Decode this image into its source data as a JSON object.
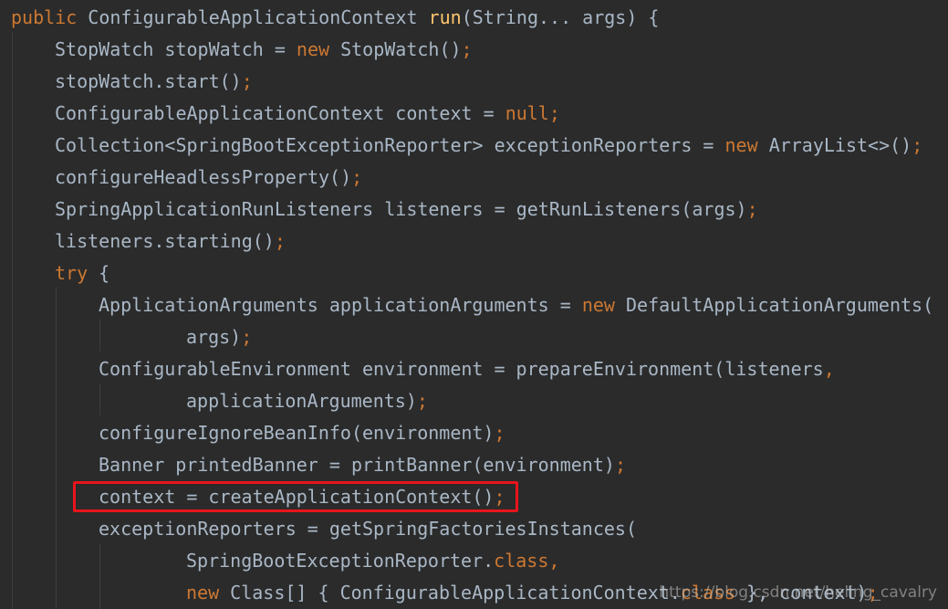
{
  "editor": {
    "lines": [
      {
        "indent": 0,
        "tokens": [
          {
            "t": "kw",
            "v": "public "
          },
          {
            "t": "plain",
            "v": "ConfigurableApplicationContext "
          },
          {
            "t": "fn",
            "v": "run"
          },
          {
            "t": "plain",
            "v": "(String... args) {"
          }
        ]
      },
      {
        "indent": 1,
        "tokens": [
          {
            "t": "plain",
            "v": "StopWatch stopWatch = "
          },
          {
            "t": "kw",
            "v": "new "
          },
          {
            "t": "plain",
            "v": "StopWatch()"
          },
          {
            "t": "punct",
            "v": ";"
          }
        ]
      },
      {
        "indent": 1,
        "tokens": [
          {
            "t": "plain",
            "v": "stopWatch.start()"
          },
          {
            "t": "punct",
            "v": ";"
          }
        ]
      },
      {
        "indent": 1,
        "tokens": [
          {
            "t": "plain",
            "v": "ConfigurableApplicationContext context = "
          },
          {
            "t": "kw",
            "v": "null"
          },
          {
            "t": "punct",
            "v": ";"
          }
        ]
      },
      {
        "indent": 1,
        "tokens": [
          {
            "t": "plain",
            "v": "Collection<SpringBootExceptionReporter> exceptionReporters = "
          },
          {
            "t": "kw",
            "v": "new "
          },
          {
            "t": "plain",
            "v": "ArrayList<>()"
          },
          {
            "t": "punct",
            "v": ";"
          }
        ]
      },
      {
        "indent": 1,
        "tokens": [
          {
            "t": "plain",
            "v": "configureHeadlessProperty()"
          },
          {
            "t": "punct",
            "v": ";"
          }
        ]
      },
      {
        "indent": 1,
        "tokens": [
          {
            "t": "plain",
            "v": "SpringApplicationRunListeners listeners = getRunListeners(args)"
          },
          {
            "t": "punct",
            "v": ";"
          }
        ]
      },
      {
        "indent": 1,
        "tokens": [
          {
            "t": "plain",
            "v": "listeners.starting()"
          },
          {
            "t": "punct",
            "v": ";"
          }
        ]
      },
      {
        "indent": 1,
        "tokens": [
          {
            "t": "kw",
            "v": "try "
          },
          {
            "t": "plain",
            "v": "{"
          }
        ]
      },
      {
        "indent": 2,
        "tokens": [
          {
            "t": "plain",
            "v": "ApplicationArguments applicationArguments = "
          },
          {
            "t": "kw",
            "v": "new "
          },
          {
            "t": "plain",
            "v": "DefaultApplicationArguments("
          }
        ]
      },
      {
        "indent": 4,
        "tokens": [
          {
            "t": "plain",
            "v": "args)"
          },
          {
            "t": "punct",
            "v": ";"
          }
        ]
      },
      {
        "indent": 2,
        "tokens": [
          {
            "t": "plain",
            "v": "ConfigurableEnvironment environment = prepareEnvironment(listeners"
          },
          {
            "t": "punct",
            "v": ","
          }
        ]
      },
      {
        "indent": 4,
        "tokens": [
          {
            "t": "plain",
            "v": "applicationArguments)"
          },
          {
            "t": "punct",
            "v": ";"
          }
        ]
      },
      {
        "indent": 2,
        "tokens": [
          {
            "t": "plain",
            "v": "configureIgnoreBeanInfo(environment)"
          },
          {
            "t": "punct",
            "v": ";"
          }
        ]
      },
      {
        "indent": 2,
        "tokens": [
          {
            "t": "plain",
            "v": "Banner printedBanner = printBanner(environment)"
          },
          {
            "t": "punct",
            "v": ";"
          }
        ]
      },
      {
        "indent": 2,
        "tokens": [
          {
            "t": "plain",
            "v": "context = createApplicationContext()"
          },
          {
            "t": "punct",
            "v": ";"
          }
        ]
      },
      {
        "indent": 2,
        "tokens": [
          {
            "t": "plain",
            "v": "exceptionReporters = getSpringFactoriesInstances("
          }
        ]
      },
      {
        "indent": 4,
        "tokens": [
          {
            "t": "plain",
            "v": "SpringBootExceptionReporter."
          },
          {
            "t": "kw",
            "v": "class"
          },
          {
            "t": "punct",
            "v": ","
          }
        ]
      },
      {
        "indent": 4,
        "tokens": [
          {
            "t": "kw",
            "v": "new "
          },
          {
            "t": "plain",
            "v": "Class[] { ConfigurableApplicationContext."
          },
          {
            "t": "kw",
            "v": "class "
          },
          {
            "t": "plain",
            "v": "}, context)"
          },
          {
            "t": "punct",
            "v": ";"
          }
        ]
      }
    ],
    "highlighted_line": 15
  },
  "colors": {
    "background": "#2b2b2b",
    "keyword": "#cc7832",
    "method": "#ffc66d",
    "text": "#a9b7c6",
    "highlight_border": "#e8141c"
  },
  "watermark": "https://blog.csdn.net/heling_cavalry"
}
